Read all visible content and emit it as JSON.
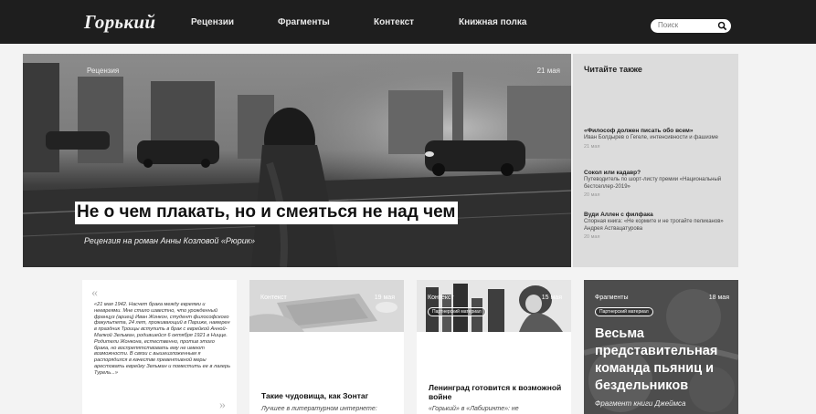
{
  "header": {
    "logo": "Горький",
    "nav": [
      "Рецензии",
      "Фрагменты",
      "Контекст",
      "Книжная полка"
    ],
    "search_placeholder": "Поиск"
  },
  "hero": {
    "tag": "Рецензия",
    "date": "21 мая",
    "title": "Не о чем плакать, но и смеяться не над чем",
    "subtitle": "Рецензия на роман Анны Козловой «Рюрик»"
  },
  "sidebar": {
    "heading": "Читайте также",
    "items": [
      {
        "title": "«Философ должен писать обо всем»",
        "text": "Иван Болдырев о Гегеле, интенсивности и фашизме",
        "date": "21 мая"
      },
      {
        "title": "Сокол или кадавр?",
        "text": "Путеводитель по шорт-листу премии «Национальный бестселлер-2019»",
        "date": "20 мая"
      },
      {
        "title": "Вуди Аллен с филфака",
        "text": "Спорная книга: «Не кормите и не трогайте пеликанов» Андрея Аствацатурова",
        "date": "20 мая"
      }
    ]
  },
  "cards": {
    "quote": {
      "open": "«",
      "text": "«21 мая 1942. Насчет брака между евреями и неевреями. Мне стало известно, что урожденный француз (ариец) Иван Жонкон, студент философского факультета, 24 лет, проживающий в Париже, намерен в праздник Троицы вступить в брак с еврейкой Анной-Малкой Зельман, родившейся 6 октября 1921 в Ницце. Родители Жонкона, естественно, против этого брака, но воспрепятствовать ему не имеют возможности. В связи с вышеизложенным я распорядился в качестве превентивной меры арестовать еврейку Зельман и поместить ее в лагерь Турель...»",
      "close": "»"
    },
    "card2": {
      "tag": "Контекст",
      "date": "19 мая",
      "title": "Такие чудовища, как Зонтаг",
      "subtitle": "Лучшее в литературном интернете:"
    },
    "card3": {
      "tag": "Контекст",
      "date": "15 мая",
      "partner": "Партнерский материал",
      "title": "Ленинград готовится к возможной войне",
      "subtitle": "«Горький» в «Лабиринте»: не"
    },
    "card4": {
      "tag": "Фрагменты",
      "date": "18 мая",
      "partner": "Партнерский материал",
      "title": "Весьма представительная команда пьяниц и бездельников",
      "subtitle": "Фрагмент книги Джеймса"
    }
  }
}
